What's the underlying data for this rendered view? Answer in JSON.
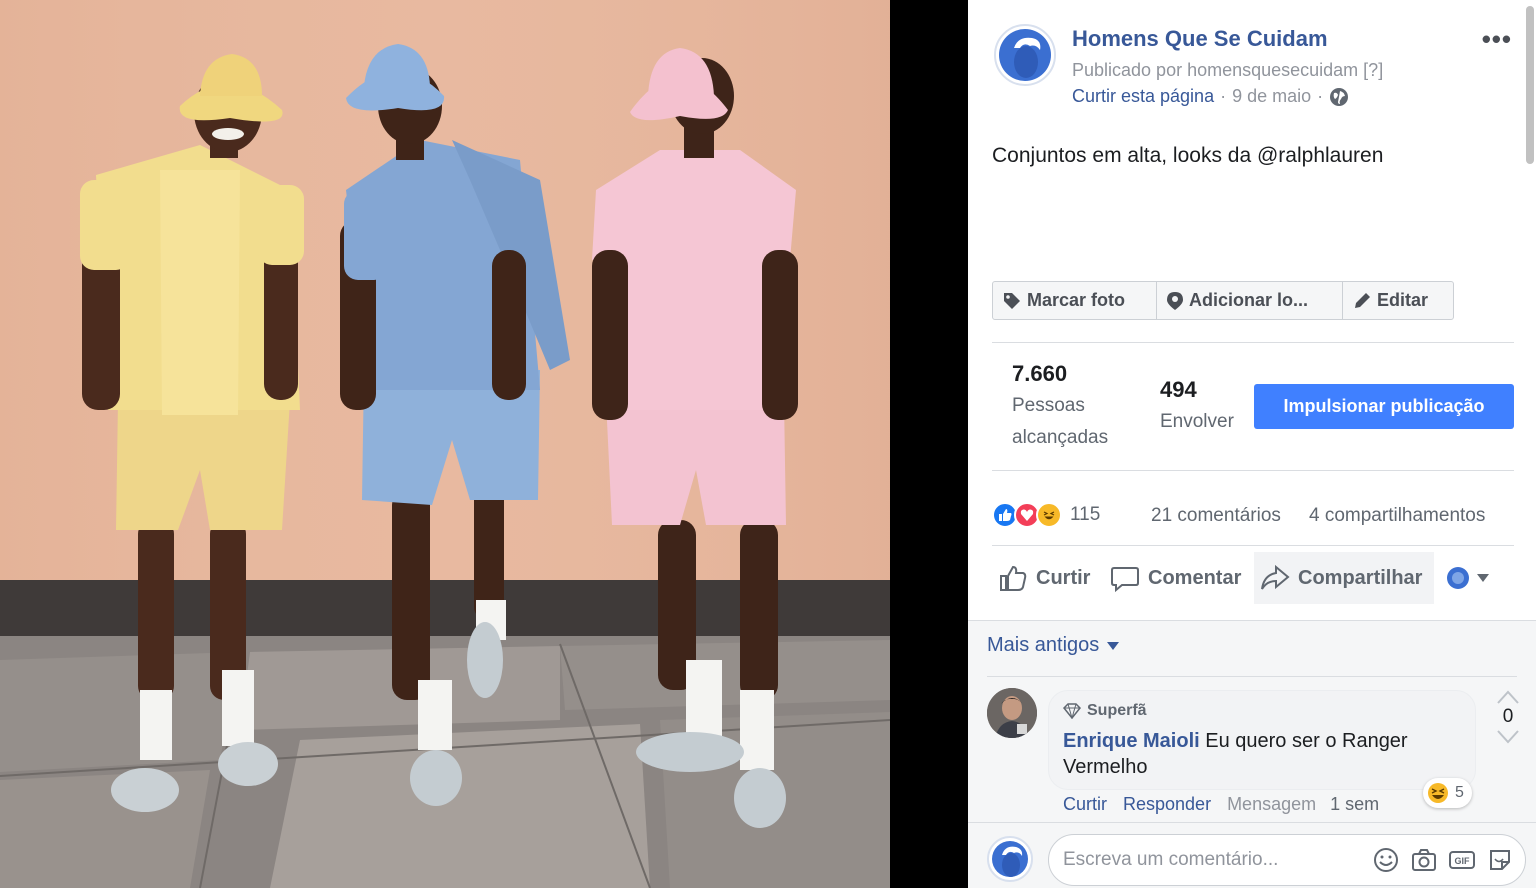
{
  "post": {
    "page_name": "Homens Que Se Cuidam",
    "published_by": "Publicado por homensquesecuidam [?]",
    "like_page": "Curtir esta página",
    "date": "9 de maio",
    "caption": "Conjuntos em alta, looks da @ralphlauren"
  },
  "tools": {
    "tag_photo": "Marcar foto",
    "add_location": "Adicionar lo...",
    "edit": "Editar"
  },
  "stats": {
    "reached_value": "7.660",
    "reached_label_1": "Pessoas",
    "reached_label_2": "alcançadas",
    "engage_value": "494",
    "engage_label": "Envolver",
    "boost_button": "Impulsionar publicação"
  },
  "reactions": {
    "count": "115",
    "comments": "21 comentários",
    "shares": "4 compartilhamentos",
    "colors": {
      "like": "#1877f2",
      "love": "#f33e58",
      "haha": "#f7b928"
    }
  },
  "actions": {
    "like": "Curtir",
    "comment": "Comentar",
    "share": "Compartilhar"
  },
  "comments": {
    "sort_label": "Mais antigos",
    "items": [
      {
        "badge": "Superfã",
        "author": "Enrique Maioli",
        "text": "Eu quero ser o Ranger Vermelho",
        "like": "Curtir",
        "reply": "Responder",
        "message": "Mensagem",
        "time": "1 sem",
        "reaction_count": "5",
        "vote_count": "0"
      }
    ],
    "composer_placeholder": "Escreva um comentário..."
  },
  "icons": [
    "tag-icon",
    "location-pin-icon",
    "pencil-icon",
    "globe-icon",
    "more-dots-icon",
    "thumbs-up-icon",
    "comment-icon",
    "share-icon",
    "audience-icon",
    "dropdown-caret-icon",
    "diamond-icon",
    "upvote-icon",
    "downvote-icon",
    "emoji-icon",
    "camera-icon",
    "gif-icon",
    "sticker-icon"
  ],
  "brand_color": "#385898",
  "button_color": "#4080ff"
}
